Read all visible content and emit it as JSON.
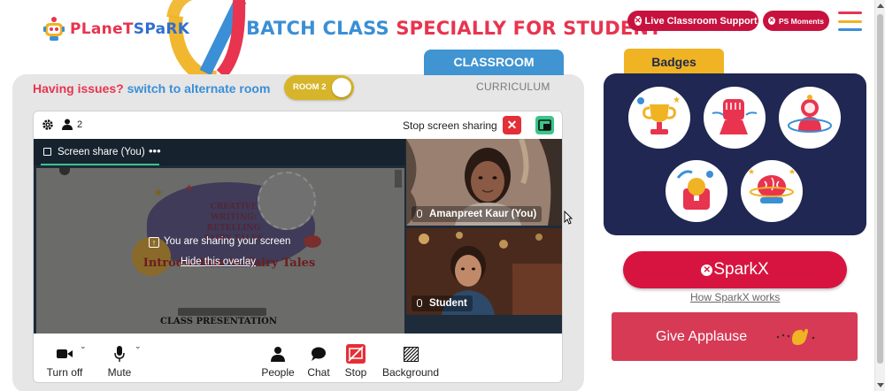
{
  "brand": {
    "name_part1": "PLaneT",
    "name_part2": "SPaRK"
  },
  "headline": {
    "part1": "BATCH CLASS ",
    "part2": "SPECIALLY FOR STUDENT"
  },
  "header_buttons": {
    "live_support": "Live Classroom Support",
    "ps_moments": "PS Moments"
  },
  "colors": {
    "red": "#e8344f",
    "blue": "#3a8fd6",
    "navy": "#1f2752",
    "yellow": "#f0b323",
    "green": "#3ac58a"
  },
  "classroom": {
    "tab_classroom": "CLASSROOM",
    "tab_curriculum": "CURRICULUM",
    "issues_text": "Having issues?",
    "switch_text": "switch to alternate room",
    "room_toggle": "ROOM 2"
  },
  "meeting": {
    "participant_count": "2",
    "stop_sharing_label": "Stop screen sharing",
    "share_tab_label": "Screen share (You)",
    "share_tab_more": "•••",
    "overlay_message": "You are sharing your screen",
    "overlay_link": "Hide this overlay",
    "slide_title": "Introduction to Fairy Tales",
    "slide_faded": "CREATIVE WRITING: RETELLING FAIRY TALES",
    "slide_footer": "CLASS PRESENTATION",
    "participants": [
      {
        "name": "Amanpreet Kaur (You)"
      },
      {
        "name": "Student"
      }
    ],
    "controls": {
      "camera": "Turn off",
      "mic": "Mute",
      "people": "People",
      "chat": "Chat",
      "stop": "Stop",
      "background": "Background"
    }
  },
  "badges": {
    "title": "Badges",
    "items": [
      "trophy-badge-icon",
      "fist-badge-icon",
      "astronaut-badge-icon",
      "bulb-badge-icon",
      "brain-badge-icon"
    ]
  },
  "sparkx": {
    "label": "SparkX",
    "how_link": "How SparkX works"
  },
  "applause": {
    "label": "Give Applause"
  }
}
